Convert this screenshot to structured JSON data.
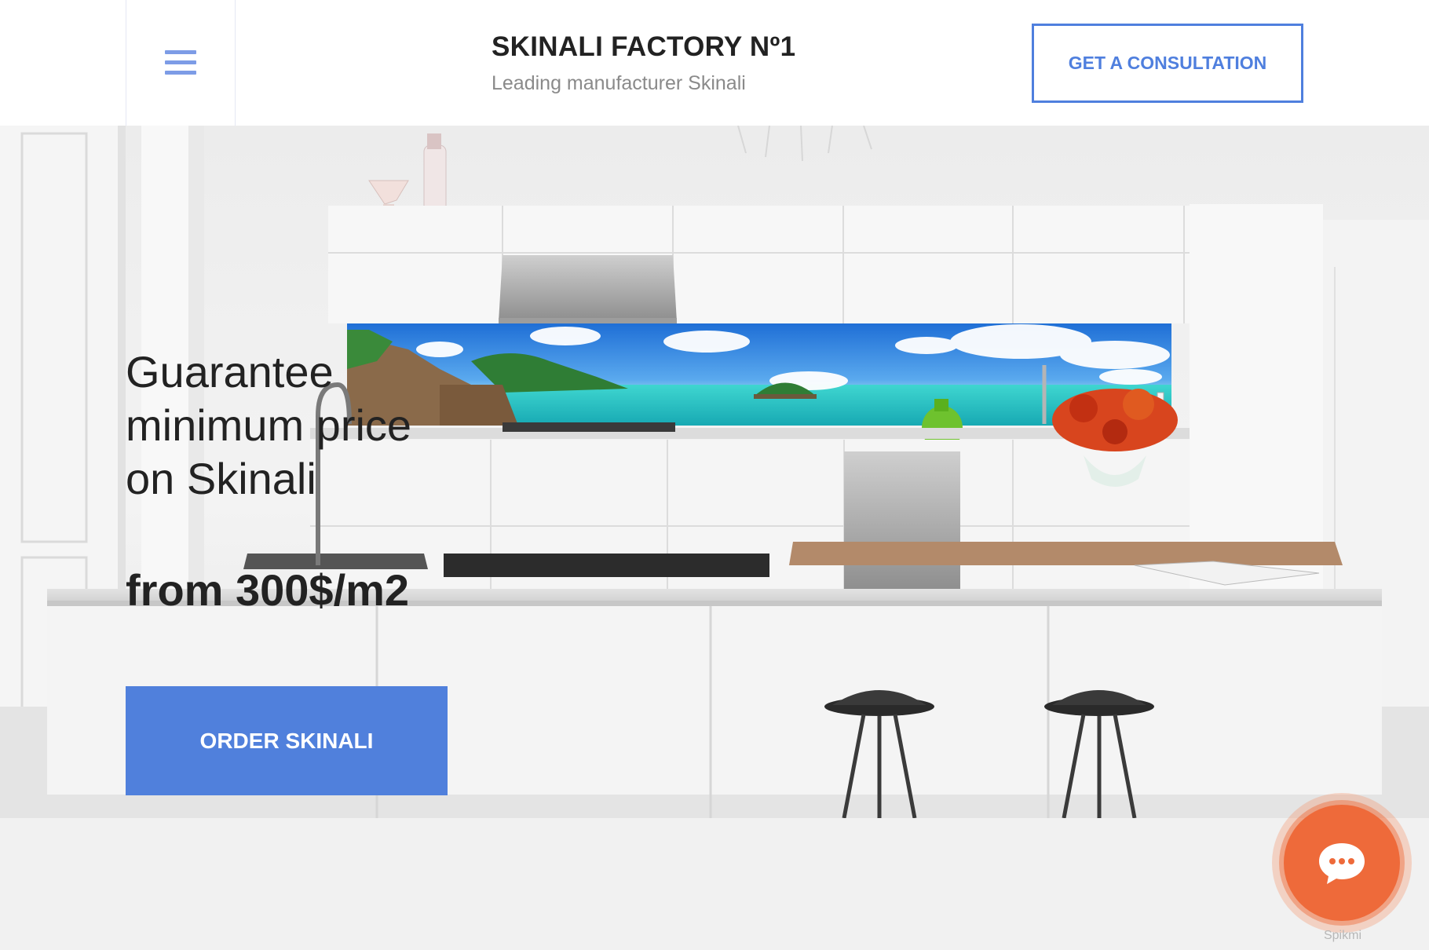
{
  "header": {
    "brand_title": "SKINALI FACTORY Nº1",
    "brand_subtitle": "Leading manufacturer Skinali",
    "consult_button": "GET A CONSULTATION",
    "menu_icon": "hamburger-menu-icon"
  },
  "hero": {
    "headline_lines": [
      "Guarantee",
      "minimum price",
      "on Skinali"
    ],
    "price": "from 300$/m2",
    "order_button": "ORDER SKINALI"
  },
  "chat": {
    "icon": "chat-bubble-icon",
    "label": "Spikmi"
  },
  "colors": {
    "accent": "#5080dc",
    "accent_border": "#4f7fde",
    "chat": "#ee6a3a",
    "text": "#222222"
  }
}
